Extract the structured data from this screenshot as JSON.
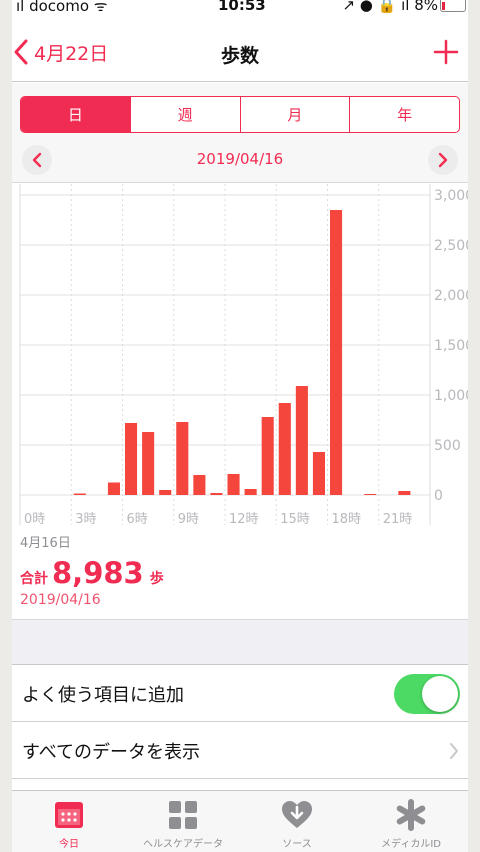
{
  "status": {
    "carrier": "ıl docomo ᯤ",
    "time": "10:53",
    "right": "↗ ● 🔒 ıl 8%"
  },
  "nav": {
    "back_label": "4月22日",
    "title": "歩数"
  },
  "segments": [
    {
      "label": "日",
      "active": true
    },
    {
      "label": "週",
      "active": false
    },
    {
      "label": "月",
      "active": false
    },
    {
      "label": "年",
      "active": false
    }
  ],
  "date_nav": {
    "label": "2019/04/16"
  },
  "summary": {
    "day_label": "4月16日",
    "total_label": "合計",
    "total_value": "8,983",
    "total_unit": "歩",
    "date": "2019/04/16"
  },
  "rows": {
    "favorite_label": "よく使う項目に追加",
    "favorite_on": true,
    "show_all_label": "すべてのデータを表示"
  },
  "tabbar": [
    {
      "label": "今日",
      "icon": "calendar-icon",
      "active": true
    },
    {
      "label": "ヘルスケアデータ",
      "icon": "grid-icon",
      "active": false
    },
    {
      "label": "ソース",
      "icon": "heart-arrow-icon",
      "active": false
    },
    {
      "label": "メディカルID",
      "icon": "asterisk-icon",
      "active": false
    }
  ],
  "colors": {
    "accent": "#f02c52",
    "bar": "#f5463e",
    "toggle_on": "#4cd964"
  },
  "chart_data": {
    "type": "bar",
    "categories": [
      "0時",
      "1時",
      "2時",
      "3時",
      "4時",
      "5時",
      "6時",
      "7時",
      "8時",
      "9時",
      "10時",
      "11時",
      "12時",
      "13時",
      "14時",
      "15時",
      "16時",
      "17時",
      "18時",
      "19時",
      "20時",
      "21時",
      "22時",
      "23時"
    ],
    "values": [
      0,
      0,
      0,
      15,
      0,
      125,
      720,
      630,
      50,
      730,
      200,
      20,
      210,
      60,
      780,
      920,
      1090,
      430,
      2850,
      0,
      10,
      0,
      40,
      0
    ],
    "x_ticks": [
      "0時",
      "3時",
      "6時",
      "9時",
      "12時",
      "15時",
      "18時",
      "21時"
    ],
    "y_ticks": [
      "0",
      "500",
      "1,000",
      "1,500",
      "2,000",
      "2,500",
      "3,000"
    ],
    "ylim": [
      0,
      3000
    ],
    "grid": true
  }
}
